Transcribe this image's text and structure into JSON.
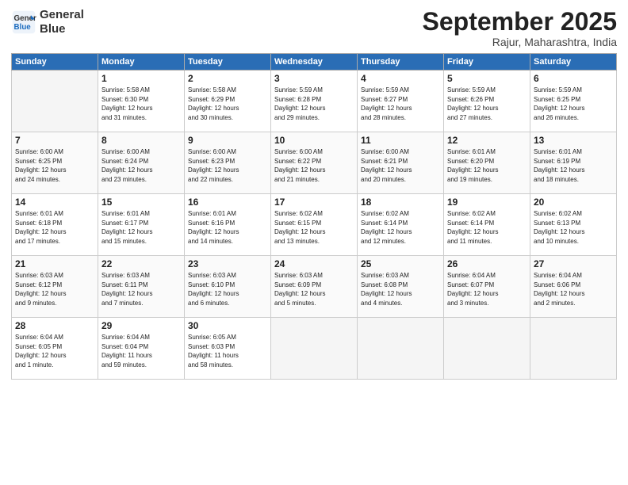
{
  "logo": {
    "line1": "General",
    "line2": "Blue"
  },
  "title": "September 2025",
  "subtitle": "Rajur, Maharashtra, India",
  "days_of_week": [
    "Sunday",
    "Monday",
    "Tuesday",
    "Wednesday",
    "Thursday",
    "Friday",
    "Saturday"
  ],
  "weeks": [
    [
      {
        "day": "",
        "info": ""
      },
      {
        "day": "1",
        "info": "Sunrise: 5:58 AM\nSunset: 6:30 PM\nDaylight: 12 hours\nand 31 minutes."
      },
      {
        "day": "2",
        "info": "Sunrise: 5:58 AM\nSunset: 6:29 PM\nDaylight: 12 hours\nand 30 minutes."
      },
      {
        "day": "3",
        "info": "Sunrise: 5:59 AM\nSunset: 6:28 PM\nDaylight: 12 hours\nand 29 minutes."
      },
      {
        "day": "4",
        "info": "Sunrise: 5:59 AM\nSunset: 6:27 PM\nDaylight: 12 hours\nand 28 minutes."
      },
      {
        "day": "5",
        "info": "Sunrise: 5:59 AM\nSunset: 6:26 PM\nDaylight: 12 hours\nand 27 minutes."
      },
      {
        "day": "6",
        "info": "Sunrise: 5:59 AM\nSunset: 6:25 PM\nDaylight: 12 hours\nand 26 minutes."
      }
    ],
    [
      {
        "day": "7",
        "info": "Sunrise: 6:00 AM\nSunset: 6:25 PM\nDaylight: 12 hours\nand 24 minutes."
      },
      {
        "day": "8",
        "info": "Sunrise: 6:00 AM\nSunset: 6:24 PM\nDaylight: 12 hours\nand 23 minutes."
      },
      {
        "day": "9",
        "info": "Sunrise: 6:00 AM\nSunset: 6:23 PM\nDaylight: 12 hours\nand 22 minutes."
      },
      {
        "day": "10",
        "info": "Sunrise: 6:00 AM\nSunset: 6:22 PM\nDaylight: 12 hours\nand 21 minutes."
      },
      {
        "day": "11",
        "info": "Sunrise: 6:00 AM\nSunset: 6:21 PM\nDaylight: 12 hours\nand 20 minutes."
      },
      {
        "day": "12",
        "info": "Sunrise: 6:01 AM\nSunset: 6:20 PM\nDaylight: 12 hours\nand 19 minutes."
      },
      {
        "day": "13",
        "info": "Sunrise: 6:01 AM\nSunset: 6:19 PM\nDaylight: 12 hours\nand 18 minutes."
      }
    ],
    [
      {
        "day": "14",
        "info": "Sunrise: 6:01 AM\nSunset: 6:18 PM\nDaylight: 12 hours\nand 17 minutes."
      },
      {
        "day": "15",
        "info": "Sunrise: 6:01 AM\nSunset: 6:17 PM\nDaylight: 12 hours\nand 15 minutes."
      },
      {
        "day": "16",
        "info": "Sunrise: 6:01 AM\nSunset: 6:16 PM\nDaylight: 12 hours\nand 14 minutes."
      },
      {
        "day": "17",
        "info": "Sunrise: 6:02 AM\nSunset: 6:15 PM\nDaylight: 12 hours\nand 13 minutes."
      },
      {
        "day": "18",
        "info": "Sunrise: 6:02 AM\nSunset: 6:14 PM\nDaylight: 12 hours\nand 12 minutes."
      },
      {
        "day": "19",
        "info": "Sunrise: 6:02 AM\nSunset: 6:14 PM\nDaylight: 12 hours\nand 11 minutes."
      },
      {
        "day": "20",
        "info": "Sunrise: 6:02 AM\nSunset: 6:13 PM\nDaylight: 12 hours\nand 10 minutes."
      }
    ],
    [
      {
        "day": "21",
        "info": "Sunrise: 6:03 AM\nSunset: 6:12 PM\nDaylight: 12 hours\nand 9 minutes."
      },
      {
        "day": "22",
        "info": "Sunrise: 6:03 AM\nSunset: 6:11 PM\nDaylight: 12 hours\nand 7 minutes."
      },
      {
        "day": "23",
        "info": "Sunrise: 6:03 AM\nSunset: 6:10 PM\nDaylight: 12 hours\nand 6 minutes."
      },
      {
        "day": "24",
        "info": "Sunrise: 6:03 AM\nSunset: 6:09 PM\nDaylight: 12 hours\nand 5 minutes."
      },
      {
        "day": "25",
        "info": "Sunrise: 6:03 AM\nSunset: 6:08 PM\nDaylight: 12 hours\nand 4 minutes."
      },
      {
        "day": "26",
        "info": "Sunrise: 6:04 AM\nSunset: 6:07 PM\nDaylight: 12 hours\nand 3 minutes."
      },
      {
        "day": "27",
        "info": "Sunrise: 6:04 AM\nSunset: 6:06 PM\nDaylight: 12 hours\nand 2 minutes."
      }
    ],
    [
      {
        "day": "28",
        "info": "Sunrise: 6:04 AM\nSunset: 6:05 PM\nDaylight: 12 hours\nand 1 minute."
      },
      {
        "day": "29",
        "info": "Sunrise: 6:04 AM\nSunset: 6:04 PM\nDaylight: 11 hours\nand 59 minutes."
      },
      {
        "day": "30",
        "info": "Sunrise: 6:05 AM\nSunset: 6:03 PM\nDaylight: 11 hours\nand 58 minutes."
      },
      {
        "day": "",
        "info": ""
      },
      {
        "day": "",
        "info": ""
      },
      {
        "day": "",
        "info": ""
      },
      {
        "day": "",
        "info": ""
      }
    ]
  ]
}
